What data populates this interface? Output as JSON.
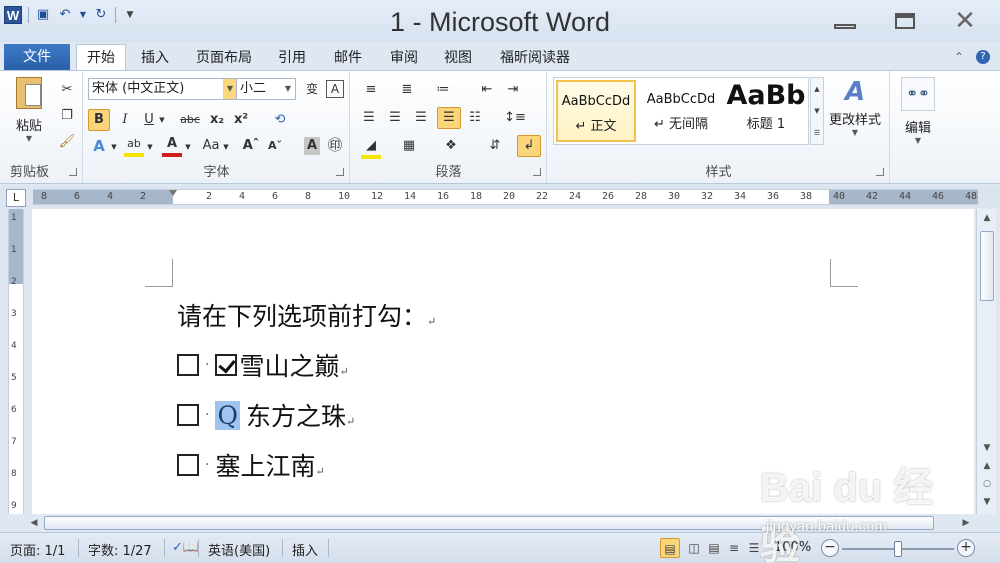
{
  "window": {
    "title": "1 - Microsoft Word",
    "app_icon": "W"
  },
  "qat": {
    "save": "save-icon",
    "undo": "undo-icon",
    "redo": "redo-icon"
  },
  "tabs": [
    "文件",
    "开始",
    "插入",
    "页面布局",
    "引用",
    "邮件",
    "审阅",
    "视图",
    "福昕阅读器"
  ],
  "active_tab": "开始",
  "clipboard": {
    "paste": "粘贴",
    "group": "剪贴板"
  },
  "font": {
    "name": "宋体 (中文正文)",
    "size": "小二",
    "group": "字体",
    "bold": "B",
    "italic": "I",
    "underline": "U",
    "strike": "abc",
    "sub": "x₂",
    "sup": "x²"
  },
  "paragraph": {
    "group": "段落"
  },
  "styles": {
    "group": "样式",
    "items": [
      {
        "preview": "AaBbCcDd",
        "name": "↵ 正文"
      },
      {
        "preview": "AaBbCcDd",
        "name": "↵ 无间隔"
      },
      {
        "preview": "AaBb",
        "name": "标题 1"
      }
    ],
    "change": "更改样式"
  },
  "editing": {
    "label": "编辑"
  },
  "ruler": {
    "ticks": [
      "8",
      "6",
      "4",
      "2",
      "",
      "2",
      "4",
      "6",
      "8",
      "10",
      "12",
      "14",
      "16",
      "18",
      "20",
      "22",
      "24",
      "26",
      "28",
      "30",
      "32",
      "34",
      "36",
      "38",
      "40",
      "42",
      "44",
      "46",
      "48"
    ],
    "vticks": [
      "1",
      "",
      "1",
      "",
      "2",
      "",
      "3",
      "",
      "4",
      "",
      "5",
      "",
      "6",
      "",
      "7",
      "",
      "8",
      "",
      "9"
    ]
  },
  "document": {
    "heading": "请在下列选项前打勾：",
    "options": [
      {
        "text": "雪山之巅",
        "checked": true,
        "prefix": ""
      },
      {
        "text": "东方之珠",
        "checked": false,
        "prefix": "Q"
      },
      {
        "text": "塞上江南",
        "checked": false,
        "prefix": ""
      }
    ],
    "pilcrow": "↵"
  },
  "status": {
    "page": "页面: 1/1",
    "words": "字数: 1/27",
    "language": "英语(美国)",
    "mode": "插入",
    "zoom": "100%"
  },
  "watermark": {
    "brand": "Bai du 经验",
    "url": "jingyan.baidu.com"
  },
  "colors": {
    "accent": "#2b579a",
    "file_tab": "#2f66b3",
    "selection": "#9fc5ee",
    "highlight": "#fbd57a"
  }
}
